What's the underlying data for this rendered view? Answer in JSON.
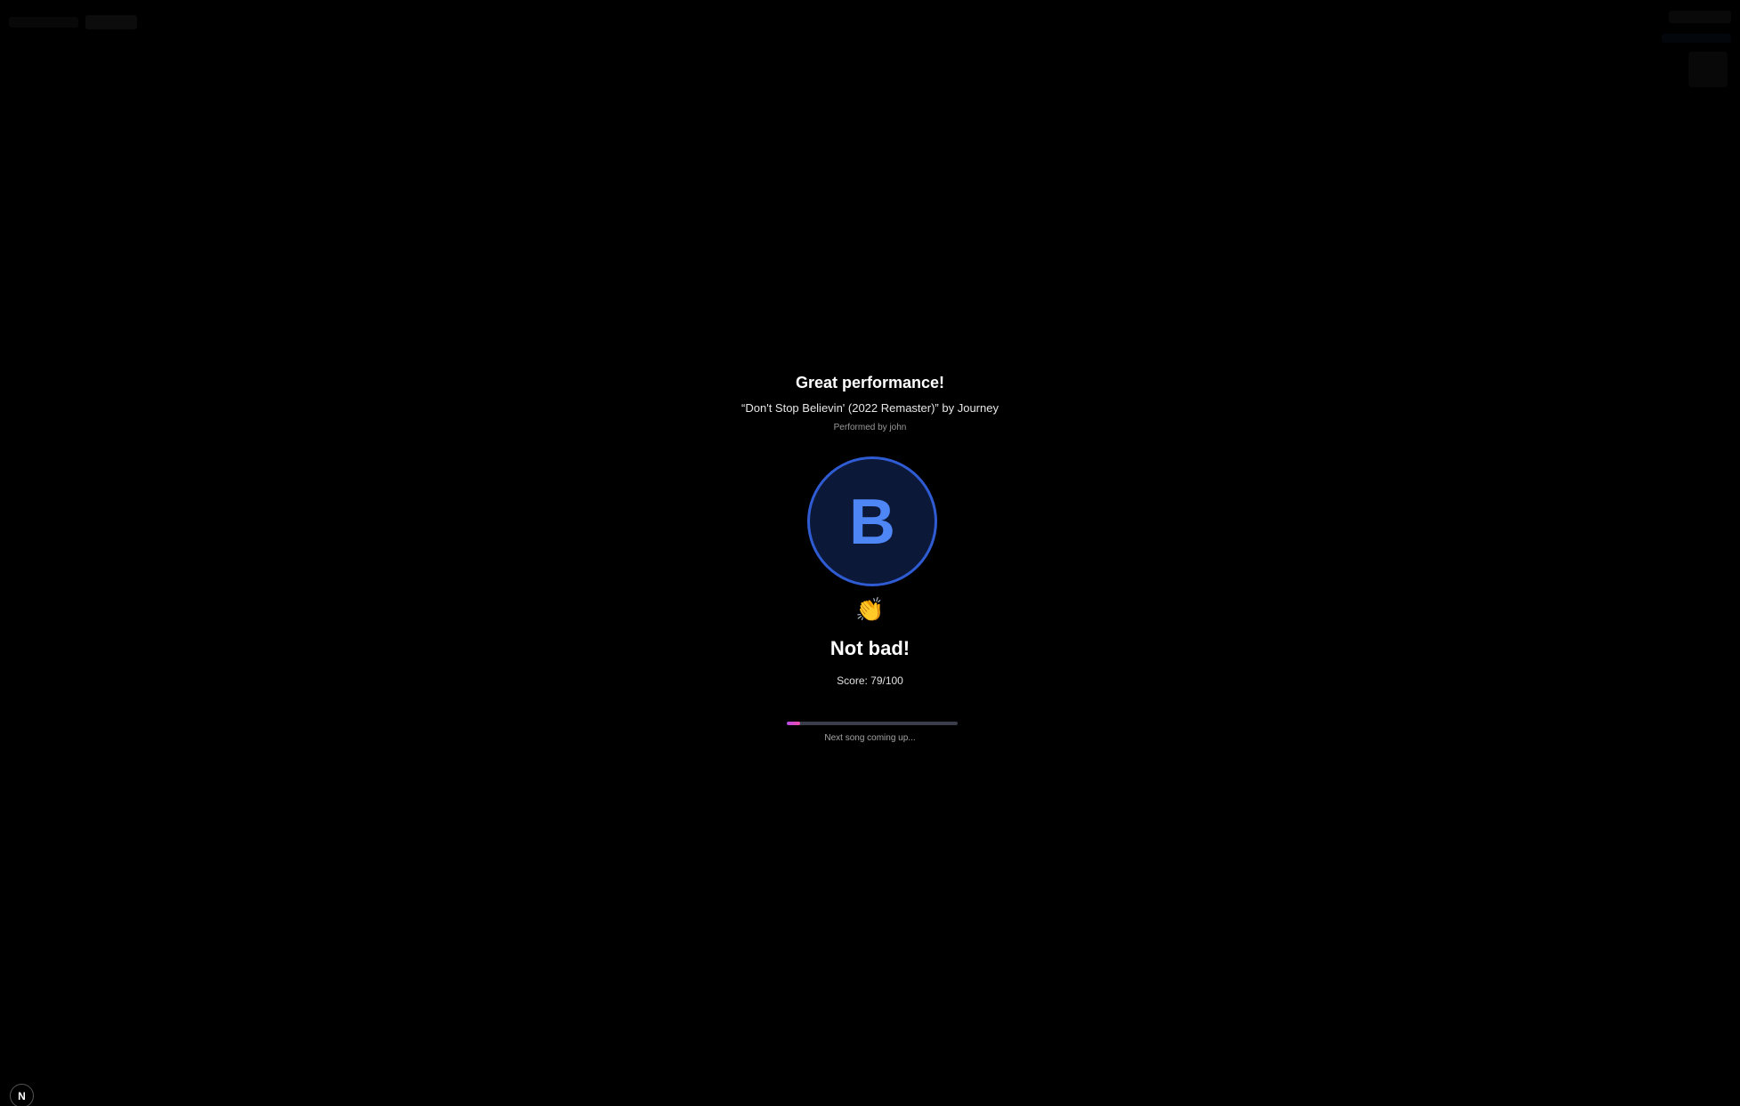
{
  "results": {
    "headline": "Great performance!",
    "song_line": "“Don't Stop Believin' (2022 Remaster)” by Journey",
    "performer": "Performed by john",
    "grade": "B",
    "reaction_emoji": "👏",
    "verdict": "Not bad!",
    "score_text": "Score: 79/100",
    "score": 79,
    "score_max": 100,
    "next_progress_fraction": 0.08,
    "next_text": "Next song coming up..."
  },
  "devtools_badge": {
    "label": "N"
  },
  "colors": {
    "background": "#000000",
    "grade_ring": "#2f5bd3",
    "grade_fill": "#0b1838",
    "grade_letter": "#4e86f5",
    "progress_fill_start": "#b84be8",
    "progress_fill_end": "#ef4ca6",
    "progress_track": "#3a3d4a"
  }
}
